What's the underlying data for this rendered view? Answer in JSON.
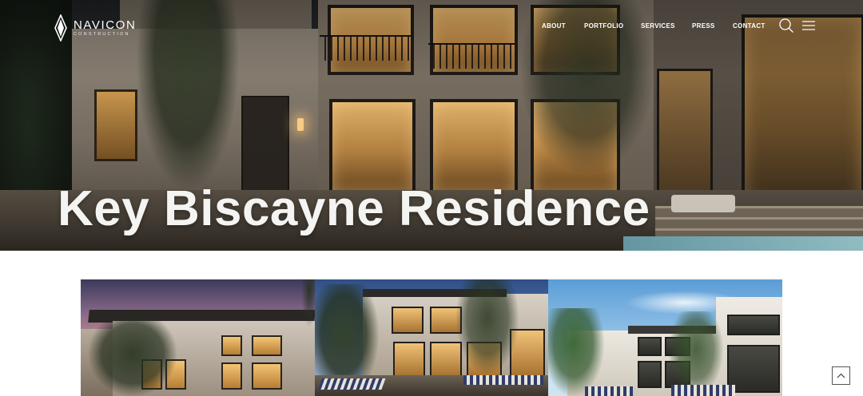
{
  "brand": {
    "name": "NAVICON",
    "subtitle": "CONSTRUCTION",
    "logo_icon": "diamond-flame-icon"
  },
  "nav": {
    "items": [
      {
        "label": "ABOUT"
      },
      {
        "label": "PORTFOLIO"
      },
      {
        "label": "SERVICES"
      },
      {
        "label": "PRESS"
      },
      {
        "label": "CONTACT"
      }
    ],
    "search_icon": "search-icon",
    "menu_icon": "hamburger-menu-icon"
  },
  "hero": {
    "title": "Key Biscayne Residence",
    "text_color": "#f4f4f2"
  },
  "gallery": {
    "images": [
      {
        "icon": "photo-residence-dusk"
      },
      {
        "icon": "photo-residence-blue-hour"
      },
      {
        "icon": "photo-residence-daylight"
      }
    ]
  },
  "back_to_top": {
    "icon": "chevron-up-icon",
    "border_color": "#555555"
  }
}
